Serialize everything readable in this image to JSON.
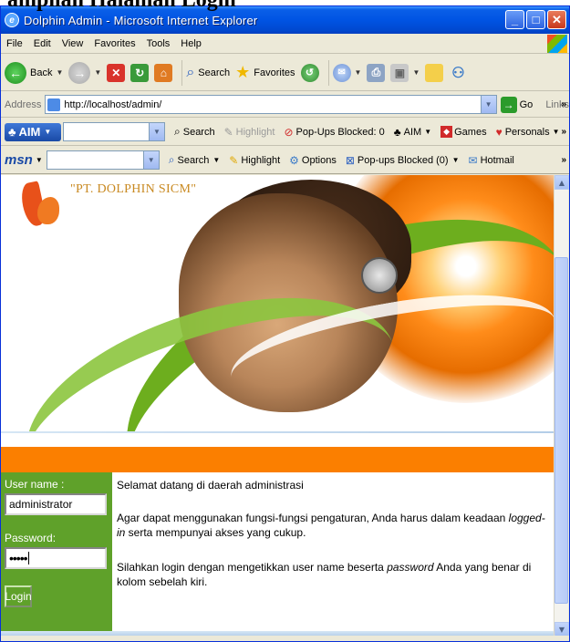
{
  "document": {
    "caption": "ampilan Halaman Login"
  },
  "window": {
    "title": "Dolphin Admin - Microsoft Internet Explorer"
  },
  "menu": {
    "items": [
      "File",
      "Edit",
      "View",
      "Favorites",
      "Tools",
      "Help"
    ]
  },
  "toolbar": {
    "back_label": "Back",
    "search_label": "Search",
    "favorites_label": "Favorites"
  },
  "address": {
    "label": "Address",
    "url": "http://localhost/admin/",
    "go_label": "Go",
    "links_label": "Links"
  },
  "aim": {
    "logo": "AIM",
    "search": "Search",
    "highlight": "Highlight",
    "popups": "Pop-Ups Blocked: 0",
    "aim_menu": "AIM",
    "games": "Games",
    "personals": "Personals"
  },
  "msn": {
    "logo": "msn",
    "search": "Search",
    "highlight": "Highlight",
    "options": "Options",
    "popups": "Pop-ups Blocked (0)",
    "hotmail": "Hotmail"
  },
  "page": {
    "company_name": "\"PT. DOLPHIN SICM\"",
    "username_label": "User name :",
    "username_value": "administrator",
    "password_label": "Password:",
    "password_mask": "•••••",
    "login_button": "Login",
    "welcome": "Selamat datang di daerah administrasi",
    "instruction_pre": "Agar dapat menggunakan fungsi-fungsi pengaturan, Anda harus dalam keadaan ",
    "instruction_em": "logged-in",
    "instruction_post": " serta mempunyai akses yang cukup.",
    "login_hint_pre": "Silahkan login dengan mengetikkan user name beserta ",
    "login_hint_em": "password",
    "login_hint_post": " Anda yang benar di kolom sebelah kiri."
  },
  "colors": {
    "titlebar": "#0054e3",
    "orange_bar": "#fb7f00",
    "sidebar_green": "#5fa12a"
  }
}
